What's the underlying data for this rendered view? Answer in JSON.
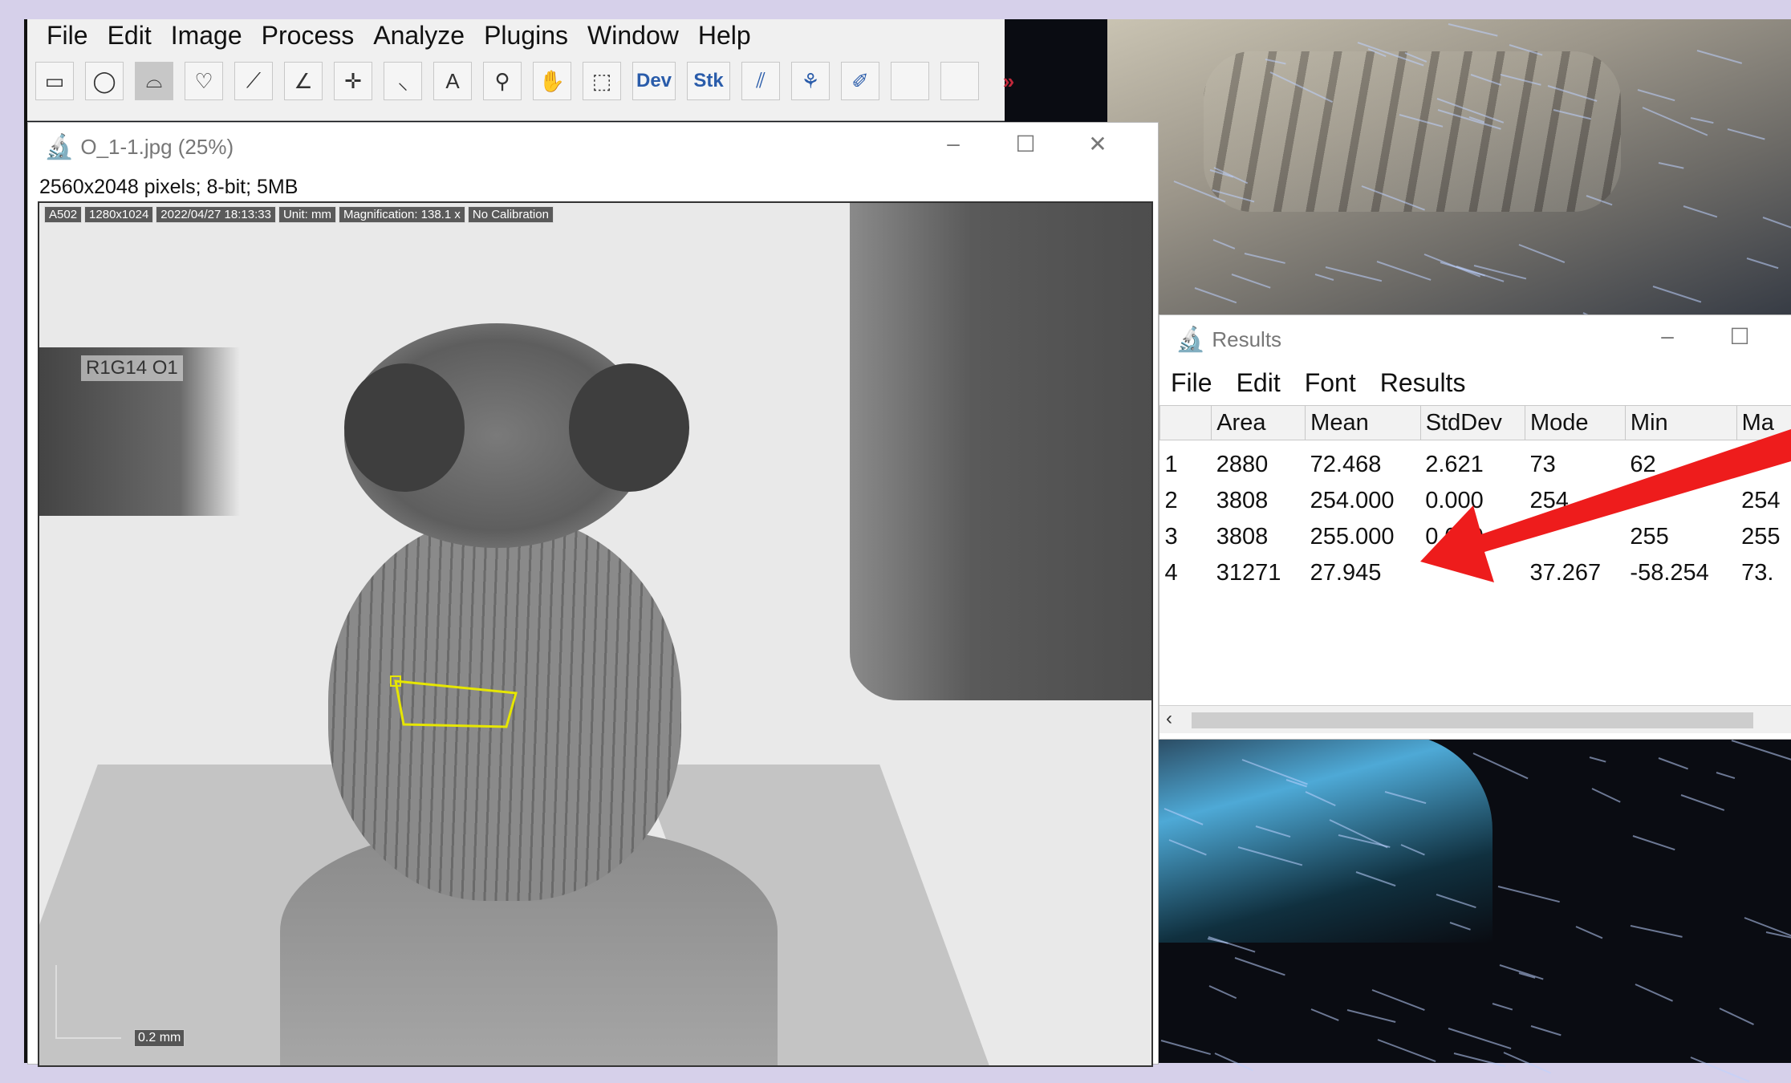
{
  "imagej": {
    "menu": [
      "File",
      "Edit",
      "Image",
      "Process",
      "Analyze",
      "Plugins",
      "Window",
      "Help"
    ],
    "tools": [
      {
        "name": "rectangle-tool-icon",
        "glyph": "▭"
      },
      {
        "name": "oval-tool-icon",
        "glyph": "◯"
      },
      {
        "name": "polygon-tool-icon",
        "glyph": "⌓",
        "selected": true
      },
      {
        "name": "freehand-tool-icon",
        "glyph": "♡"
      },
      {
        "name": "line-tool-icon",
        "glyph": "⟋"
      },
      {
        "name": "angle-tool-icon",
        "glyph": "∠"
      },
      {
        "name": "point-tool-icon",
        "glyph": "✛"
      },
      {
        "name": "wand-tool-icon",
        "glyph": "⸜"
      },
      {
        "name": "text-tool-icon",
        "glyph": "A"
      },
      {
        "name": "zoom-tool-icon",
        "glyph": "⚲"
      },
      {
        "name": "hand-tool-icon",
        "glyph": "✋"
      },
      {
        "name": "dropper-tool-icon",
        "glyph": "⬚"
      },
      {
        "name": "dev-tool",
        "glyph": "Dev"
      },
      {
        "name": "stk-tool",
        "glyph": "Stk"
      },
      {
        "name": "brush-tool-icon",
        "glyph": "⫽"
      },
      {
        "name": "macro-tool-icon",
        "glyph": "⚘"
      },
      {
        "name": "pin-tool-icon",
        "glyph": "✐"
      },
      {
        "name": "empty-tool-1",
        "glyph": ""
      },
      {
        "name": "empty-tool-2",
        "glyph": ""
      },
      {
        "name": "more-tools-icon",
        "glyph": "»"
      }
    ]
  },
  "image_window": {
    "title": "O_1-1.jpg (25%)",
    "info": "2560x2048 pixels; 8-bit; 5MB",
    "stamp": [
      "A502",
      "1280x1024",
      "2022/04/27 18:13:33",
      "Unit: mm",
      "Magnification: 138.1 x",
      "No Calibration"
    ],
    "label": "R1G14 O1",
    "scale_label": "0.2 mm"
  },
  "results_window": {
    "title": "Results",
    "menu": [
      "File",
      "Edit",
      "Font",
      "Results"
    ],
    "headers": [
      "",
      "Area",
      "Mean",
      "StdDev",
      "Mode",
      "Min",
      "Ma"
    ],
    "rows": [
      [
        "1",
        "2880",
        "72.468",
        "2.621",
        "73",
        "62",
        ""
      ],
      [
        "2",
        "3808",
        "254.000",
        "0.000",
        "254",
        "",
        "254"
      ],
      [
        "3",
        "3808",
        "255.000",
        "0.000",
        "",
        "255",
        "255"
      ],
      [
        "4",
        "31271",
        "27.945",
        "",
        "37.267",
        "-58.254",
        "73."
      ]
    ]
  },
  "window_controls": {
    "minimize": "–",
    "maximize": "☐",
    "close": "✕"
  },
  "colors": {
    "arrow": "#ee1c1c",
    "roi": "#e6e600",
    "desktop": "#d6d0ea"
  }
}
